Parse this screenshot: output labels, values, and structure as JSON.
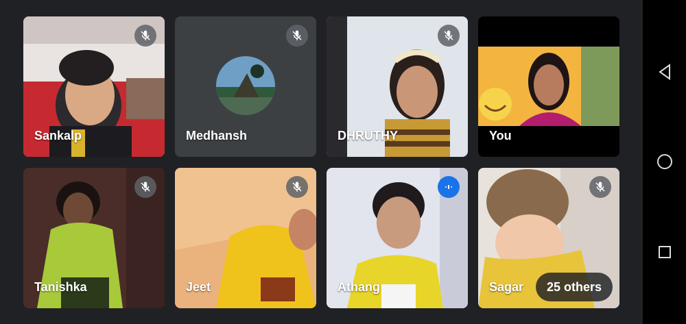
{
  "participants": [
    {
      "name": "Sankalp",
      "mic": "muted"
    },
    {
      "name": "Medhansh",
      "mic": "muted"
    },
    {
      "name": "DHRUTHY",
      "mic": "muted"
    },
    {
      "name": "You",
      "mic": "none"
    },
    {
      "name": "Tanishka",
      "mic": "muted"
    },
    {
      "name": "Jeet",
      "mic": "muted"
    },
    {
      "name": "Athang",
      "mic": "speaking"
    },
    {
      "name": "Sagar",
      "mic": "muted"
    }
  ],
  "others_label": "25 others",
  "colors": {
    "background": "#202124",
    "tile_background": "#3c4043",
    "speaking_badge": "#1a73e8",
    "mute_badge": "#5f6368"
  },
  "navigation": {
    "back": "back-triangle-icon",
    "home": "home-circle-icon",
    "recents": "recents-square-icon"
  }
}
